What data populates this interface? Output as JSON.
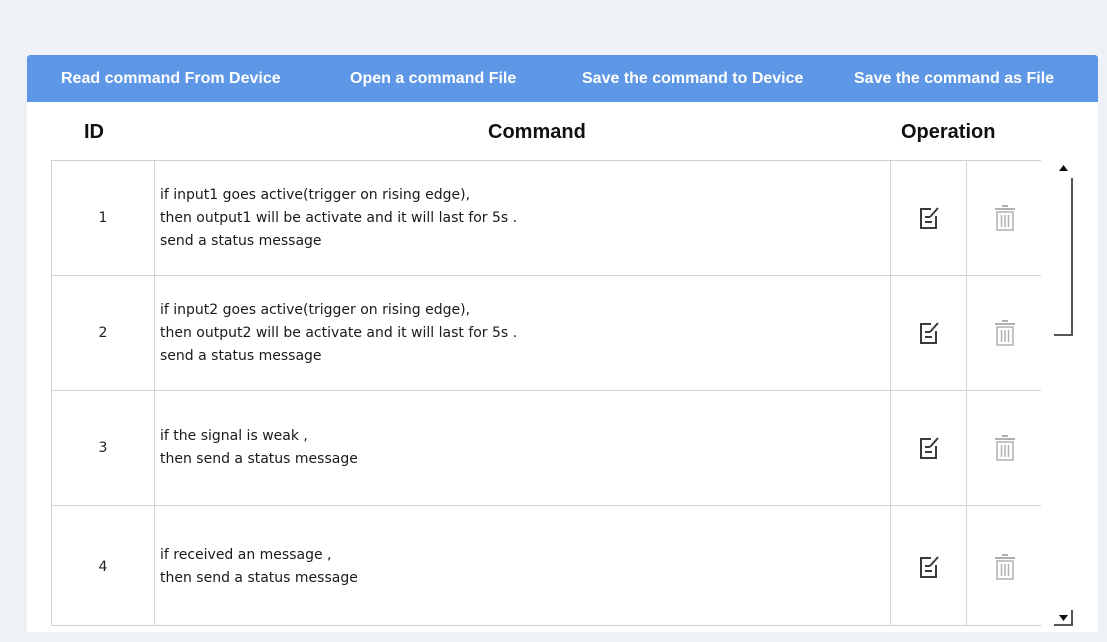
{
  "toolbar": {
    "read_label": "Read command From Device",
    "open_label": "Open a command File",
    "save_device_label": "Save the command to Device",
    "save_file_label": "Save the command as File",
    "bg_color": "#5e97e6"
  },
  "table": {
    "headers": {
      "id": "ID",
      "command": "Command",
      "operation": "Operation"
    },
    "rows": [
      {
        "id": "1",
        "lines": [
          "if input1 goes active(trigger on rising edge),",
          "then output1 will be activate and it will last for 5s .",
          "send a status message"
        ]
      },
      {
        "id": "2",
        "lines": [
          "if input2 goes active(trigger on rising edge),",
          "then output2 will be activate and it will last for 5s .",
          "send a status message"
        ]
      },
      {
        "id": "3",
        "lines": [
          "if the signal is weak ,",
          "then send a status message"
        ]
      },
      {
        "id": "4",
        "lines": [
          "if received an message ,",
          "then send a status message"
        ]
      }
    ],
    "row_icons": {
      "edit": "edit-icon",
      "delete": "trash-icon"
    }
  },
  "scrollbar": {
    "up_icon": "scroll-up-arrow-icon",
    "down_icon": "scroll-down-arrow-icon"
  }
}
